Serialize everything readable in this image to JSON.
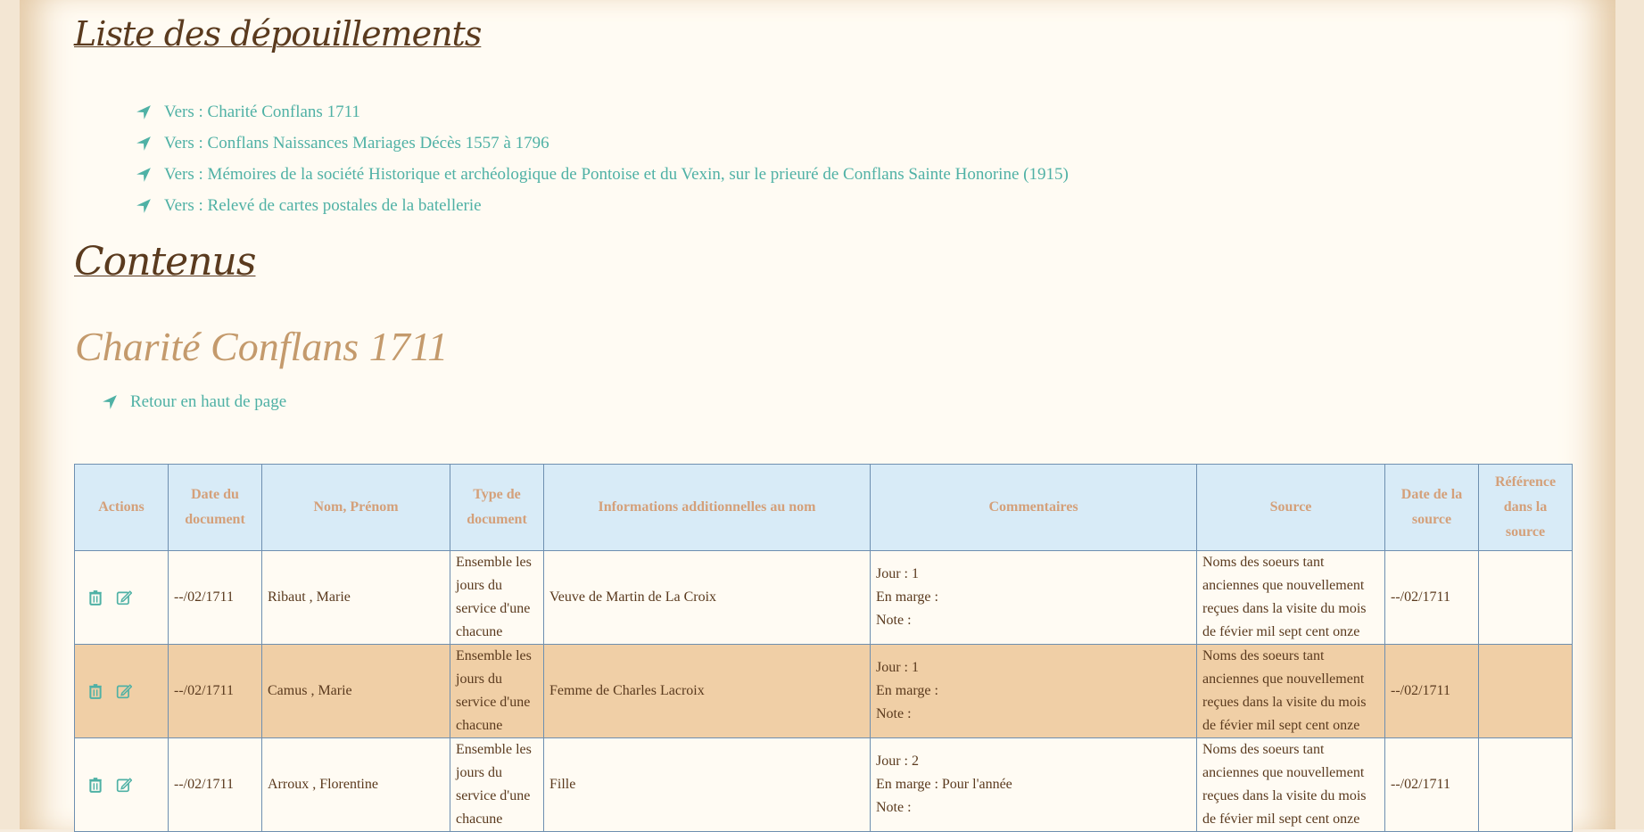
{
  "sections": {
    "liste_title": "Liste des dépouillements",
    "contenus_title": "Contenus"
  },
  "links": [
    "Vers : Charité Conflans 1711",
    "Vers : Conflans Naissances Mariages Décès 1557 à 1796",
    "Vers : Mémoires de la société Historique et archéologique de Pontoise et du Vexin, sur le prieuré de Conflans Sainte Honorine (1915)",
    "Vers : Relevé de cartes postales de la batellerie"
  ],
  "subsection": {
    "title": "Charité Conflans 1711",
    "back_link": "Retour en haut de page"
  },
  "table": {
    "headers": [
      "Actions",
      "Date du document",
      "Nom, Prénom",
      "Type de document",
      "Informations additionnelles au nom",
      "Commentaires",
      "Source",
      "Date de la source",
      "Référence dans la source"
    ],
    "rows": [
      {
        "date": "--/02/1711",
        "name": "Ribaut , Marie",
        "type": "Ensemble les jours du service d'une chacune",
        "info": "Veuve de Martin de La Croix",
        "comment": [
          "Jour : 1",
          "En marge :",
          "Note :"
        ],
        "source": "Noms des soeurs tant anciennes que nouvellement reçues dans la visite du mois de févier mil sept cent onze",
        "source_date": "--/02/1711",
        "reference": ""
      },
      {
        "date": "--/02/1711",
        "name": "Camus , Marie",
        "type": "Ensemble les jours du service d'une chacune",
        "info": "Femme de Charles Lacroix",
        "comment": [
          "Jour : 1",
          "En marge :",
          "Note :"
        ],
        "source": "Noms des soeurs tant anciennes que nouvellement reçues dans la visite du mois de févier mil sept cent onze",
        "source_date": "--/02/1711",
        "reference": ""
      },
      {
        "date": "--/02/1711",
        "name": "Arroux , Florentine",
        "type": "Ensemble les jours du service d'une chacune",
        "info": "Fille",
        "comment": [
          "Jour : 2",
          "En marge : Pour l'année",
          "Note :"
        ],
        "source": "Noms des soeurs tant anciennes que nouvellement reçues dans la visite du mois de févier mil sept cent onze",
        "source_date": "--/02/1711",
        "reference": ""
      }
    ]
  },
  "colors": {
    "link": "#4fb1a5",
    "heading": "#5a3a1e",
    "subtitle": "#c49a6c",
    "header_bg": "#d8ebf7",
    "header_text": "#d4a07a",
    "row_alt_bg": "#f0cfa6"
  },
  "icons": {
    "link_arrow": "location-arrow-icon",
    "delete": "trash-icon",
    "edit": "edit-icon"
  }
}
